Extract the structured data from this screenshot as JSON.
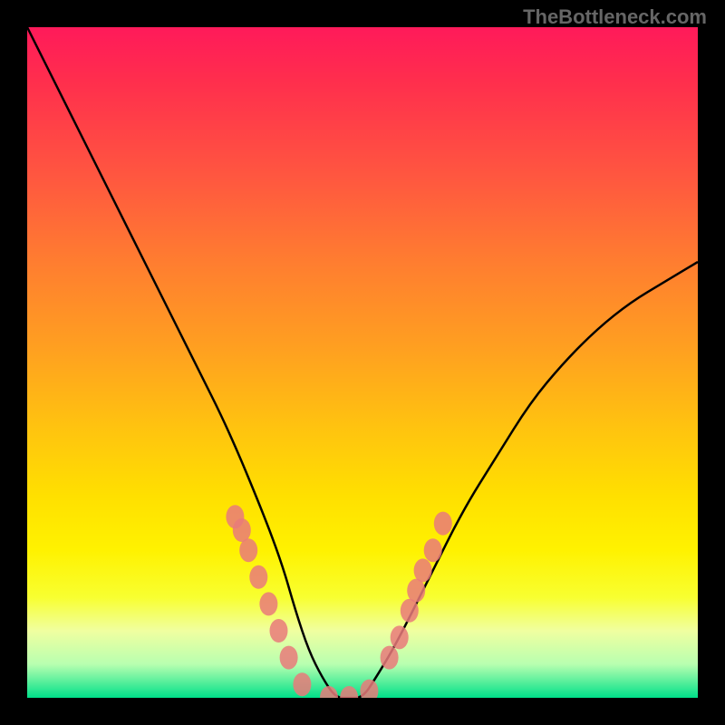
{
  "watermark": "TheBottleneck.com",
  "chart_data": {
    "type": "line",
    "title": "",
    "xlabel": "",
    "ylabel": "",
    "xlim": [
      0,
      100
    ],
    "ylim": [
      0,
      100
    ],
    "legend": false,
    "grid": false,
    "background": "rainbow-vertical-gradient",
    "series": [
      {
        "name": "bottleneck-curve",
        "color": "#000000",
        "x": [
          0,
          5,
          10,
          15,
          20,
          25,
          30,
          35,
          38,
          40,
          42,
          44,
          46,
          48,
          50,
          52,
          55,
          60,
          65,
          70,
          75,
          80,
          85,
          90,
          95,
          100
        ],
        "values": [
          100,
          90,
          80,
          70,
          60,
          50,
          40,
          28,
          20,
          13,
          7,
          3,
          0,
          0,
          0,
          3,
          8,
          18,
          28,
          36,
          44,
          50,
          55,
          59,
          62,
          65
        ]
      }
    ],
    "markers": {
      "name": "highlighted-points",
      "color": "#e97a7a",
      "points": [
        {
          "x": 31,
          "y": 27
        },
        {
          "x": 32,
          "y": 25
        },
        {
          "x": 33,
          "y": 22
        },
        {
          "x": 34.5,
          "y": 18
        },
        {
          "x": 36,
          "y": 14
        },
        {
          "x": 37.5,
          "y": 10
        },
        {
          "x": 39,
          "y": 6
        },
        {
          "x": 41,
          "y": 2
        },
        {
          "x": 45,
          "y": 0
        },
        {
          "x": 48,
          "y": 0
        },
        {
          "x": 51,
          "y": 1
        },
        {
          "x": 54,
          "y": 6
        },
        {
          "x": 55.5,
          "y": 9
        },
        {
          "x": 57,
          "y": 13
        },
        {
          "x": 58,
          "y": 16
        },
        {
          "x": 59,
          "y": 19
        },
        {
          "x": 60.5,
          "y": 22
        },
        {
          "x": 62,
          "y": 26
        }
      ]
    }
  }
}
